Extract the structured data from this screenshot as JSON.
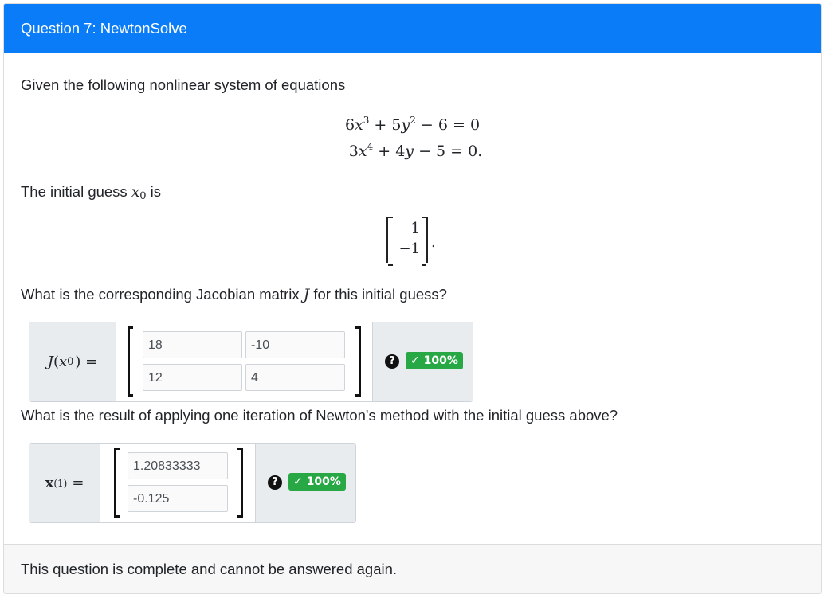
{
  "header": {
    "title": "Question 7: NewtonSolve"
  },
  "intro": "Given the following nonlinear system of equations",
  "equations": {
    "eq1": {
      "c1": "6",
      "v1": "x",
      "p1": "3",
      "c2": " + 5",
      "v2": "y",
      "p2": "2",
      "rest": " − 6 = 0"
    },
    "eq2": {
      "c1": "3",
      "v1": "x",
      "p1": "4",
      "c2": " + 4",
      "v2": "y",
      "rest": " − 5 = 0."
    }
  },
  "guess_text": {
    "before": "The initial guess ",
    "var": "x",
    "sub": "0",
    "after": " is"
  },
  "initial_guess": [
    "1",
    "−1"
  ],
  "q1": {
    "prompt_before": "What is the corresponding Jacobian matrix ",
    "prompt_var": "J",
    "prompt_after": " for this initial guess?",
    "label_fn": "J",
    "label_open": "(",
    "label_var": "x",
    "label_sub": "0",
    "label_close": ") =",
    "cells": [
      "18",
      "-10",
      "12",
      "4"
    ],
    "help": "?",
    "score": "✓ 100%"
  },
  "q2": {
    "prompt": "What is the result of applying one iteration of Newton's method with the initial guess above?",
    "label_var": "x",
    "label_sup": "(1)",
    "label_eq": "=",
    "cells": [
      "1.20833333",
      "-0.125"
    ],
    "help": "?",
    "score": "✓ 100%"
  },
  "footer": {
    "text": "This question is complete and cannot be answered again."
  }
}
